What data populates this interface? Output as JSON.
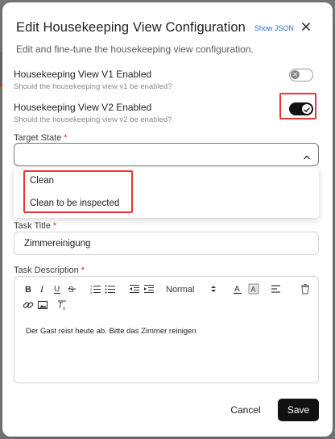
{
  "modal": {
    "title": "Edit Housekeeping View Configuration",
    "show_json_label": "Show JSON",
    "subtitle": "Edit and fine-tune the housekeeping view configuration."
  },
  "toggles": [
    {
      "label": "Housekeeping View V1 Enabled",
      "help": "Should the housekeeping view v1 be enabled?",
      "enabled": false
    },
    {
      "label": "Housekeeping View V2 Enabled",
      "help": "Should the housekeeping view v2 be enabled?",
      "enabled": true
    }
  ],
  "target_state": {
    "label": "Target State",
    "required_marker": "*",
    "value": "",
    "options": [
      "Clean",
      "Clean to be inspected"
    ]
  },
  "task_title": {
    "label": "Task Title",
    "required_marker": "*",
    "value": "Zimmereinigung"
  },
  "task_description": {
    "label": "Task Description",
    "required_marker": "*",
    "format_select": "Normal",
    "body": "Der Gast reist heute ab. Bitte das Zimmer reinigen"
  },
  "footer": {
    "cancel_label": "Cancel",
    "save_label": "Save"
  },
  "colors": {
    "accent_link": "#2f6fd6",
    "primary_button": "#111111",
    "highlight": "#e53935",
    "required": "#d32f2f"
  }
}
